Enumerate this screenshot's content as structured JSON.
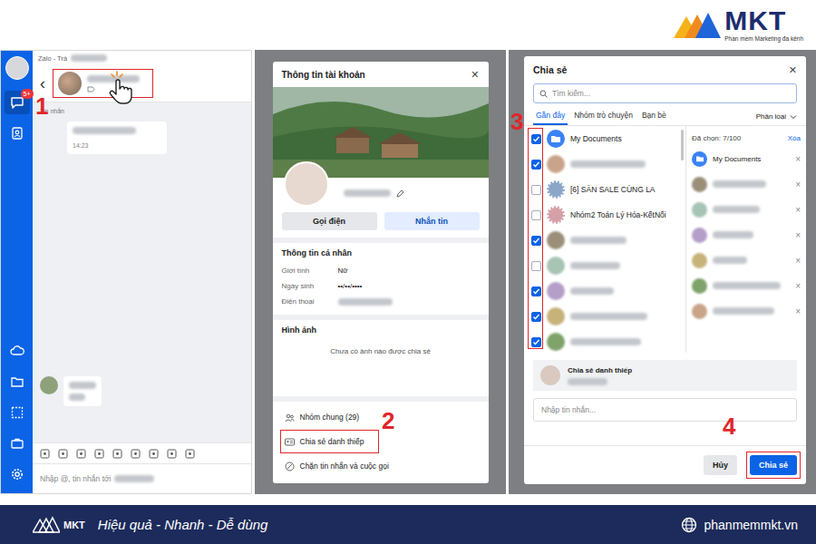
{
  "brand": {
    "name": "MKT",
    "tagline": "Phần mềm Marketing đa kênh"
  },
  "chat": {
    "step": "1",
    "app_title": "Zalo - Trà",
    "unread_badge": "5+",
    "back_glyph": "‹",
    "section_label": "Tin nhắn",
    "message_time": "14:23",
    "input_placeholder": "Nhập @, tin nhắn tới"
  },
  "profile": {
    "step": "2",
    "title": "Thông tin tài khoản",
    "close_glyph": "✕",
    "actions": [
      {
        "label": "Gọi điện",
        "primary": false
      },
      {
        "label": "Nhắn tin",
        "primary": true
      }
    ],
    "personal_title": "Thông tin cá nhân",
    "fields": [
      {
        "label": "Giới tính",
        "value": "Nữ",
        "blurred": false
      },
      {
        "label": "Ngày sinh",
        "value": "••/••/••••",
        "blurred": false
      },
      {
        "label": "Điện thoại",
        "blurred": true
      }
    ],
    "photos_title": "Hình ảnh",
    "photos_empty": "Chưa có ảnh nào được chia sẻ",
    "menu": [
      {
        "label": "Nhóm chung (29)",
        "kind": "groups",
        "highlighted": false
      },
      {
        "label": "Chia sẻ danh thiếp",
        "kind": "card",
        "highlighted": true
      },
      {
        "label": "Chặn tin nhắn và cuộc gọi",
        "kind": "block",
        "highlighted": false
      }
    ]
  },
  "share": {
    "step_list": "3",
    "step_button": "4",
    "title": "Chia sẻ",
    "close_glyph": "✕",
    "search_placeholder": "Tìm kiếm...",
    "tabs": [
      {
        "label": "Gần đây",
        "selected": true
      },
      {
        "label": "Nhóm trò chuyện",
        "selected": false
      },
      {
        "label": "Bạn bè",
        "selected": false
      }
    ],
    "filter": "Phân loại",
    "contacts": [
      {
        "name": "My Documents",
        "kind": "documents",
        "checked": true
      },
      {
        "kind": "person",
        "checked": true
      },
      {
        "name": "[6] SĂN SALE CÙNG LA",
        "kind": "group",
        "checked": false
      },
      {
        "name": "Nhóm2 Toán Lý Hóa-KếtNối",
        "kind": "group",
        "checked": false
      },
      {
        "kind": "person",
        "checked": true
      },
      {
        "kind": "person",
        "checked": false
      },
      {
        "kind": "person",
        "checked": true
      },
      {
        "kind": "person",
        "checked": true
      },
      {
        "kind": "person",
        "checked": true
      }
    ],
    "selected_count": "Đã chọn: 7/100",
    "clear": "Xóa",
    "selected": [
      {
        "name": "My Documents",
        "kind": "documents"
      },
      {
        "kind": "person"
      },
      {
        "kind": "person"
      },
      {
        "kind": "person"
      },
      {
        "kind": "person"
      },
      {
        "kind": "person"
      },
      {
        "kind": "person"
      }
    ],
    "remove_glyph": "×",
    "card_label": "Chia sẻ danh thiếp",
    "message_placeholder": "Nhập tin nhắn...",
    "buttons": [
      {
        "label": "Hủy",
        "primary": false,
        "highlighted": false
      },
      {
        "label": "Chia sẻ",
        "primary": true,
        "highlighted": true
      }
    ]
  },
  "footer": {
    "logo": "MKT",
    "slogan": "Hiệu quả - Nhanh - Dễ dùng",
    "website": "phanmemmkt.vn"
  }
}
